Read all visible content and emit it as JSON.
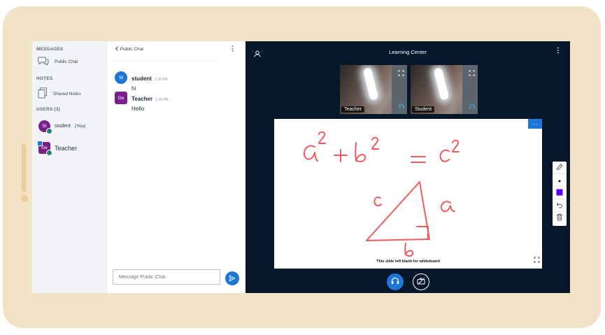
{
  "userlist": {
    "messages_title": "MESSAGES",
    "public_chat_label": "Public Chat",
    "notes_title": "NOTES",
    "shared_notes_label": "Shared Notes",
    "users_title": "USERS (3)",
    "users": [
      {
        "initials": "St",
        "name": "student",
        "suffix": "(You)",
        "color": "#7a1e8c"
      },
      {
        "initials": "Ge",
        "name": "Teacher",
        "suffix": "",
        "color": "#7a1e8c"
      }
    ]
  },
  "chat": {
    "header": "Public Chat",
    "messages": [
      {
        "initials": "St",
        "name": "student",
        "time": "1:28 PM",
        "text": "hi",
        "color": "#1e76d6"
      },
      {
        "initials": "Ge",
        "name": "Teacher",
        "time": "1:29 PM",
        "text": "Hello",
        "color": "#7a1e8c"
      }
    ],
    "input_placeholder": "Message Public Chat"
  },
  "main": {
    "title": "Learning Center",
    "videos": [
      {
        "label": "Teacher"
      },
      {
        "label": "Student"
      }
    ],
    "whiteboard": {
      "caption": "This slide left blank for whiteboard",
      "more_label": "···",
      "ink_color": "#f25a5a"
    },
    "tools": {
      "current_color": "#5b00ff"
    }
  },
  "icons": {
    "back": "chevron-left-icon",
    "kebab": "more-vertical-icon",
    "chat": "chat-bubbles-icon",
    "notes": "notes-icon",
    "send": "send-icon",
    "user": "user-icon",
    "headset": "headset-icon",
    "expand": "expand-icon",
    "camera": "camera-off-icon",
    "pencil": "pencil-icon",
    "undo": "undo-icon",
    "trash": "trash-icon"
  },
  "colors": {
    "accent": "#1e76d6",
    "background_main": "#06172a",
    "frame": "#f2e3c6"
  }
}
